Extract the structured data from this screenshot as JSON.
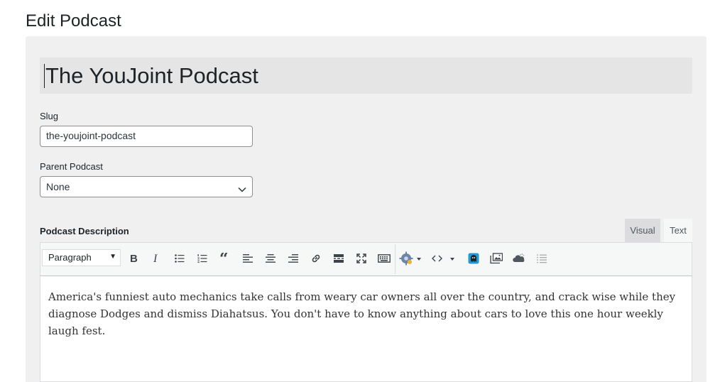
{
  "page": {
    "title": "Edit Podcast"
  },
  "post_title": {
    "value": "The YouJoint Podcast"
  },
  "slug": {
    "label": "Slug",
    "value": "the-youjoint-podcast"
  },
  "parent": {
    "label": "Parent Podcast",
    "selected": "None"
  },
  "description": {
    "label": "Podcast Description",
    "tabs": {
      "visual": "Visual",
      "text": "Text"
    },
    "active_tab": "Visual",
    "format_select": "Paragraph",
    "toolbar_icons": [
      "bold-icon",
      "italic-icon",
      "bullet-list-icon",
      "numbered-list-icon",
      "blockquote-icon",
      "align-left-icon",
      "align-center-icon",
      "align-right-icon",
      "link-icon",
      "read-more-icon",
      "fullscreen-icon",
      "keyboard-icon",
      "shortcode-gear-icon",
      "code-icon",
      "ghost-icon",
      "gallery-icon",
      "cloud-icon",
      "list-icon"
    ],
    "content": "America's funniest auto mechanics take calls from weary car owners all over the country, and crack wise while they diagnose Dodges and dismiss Diahatsus. You don't have to know anything about cars to love this one hour weekly laugh fest."
  },
  "colors": {
    "panel_bg": "#f0f0f1",
    "accent_blue": "#1e9bd7"
  }
}
